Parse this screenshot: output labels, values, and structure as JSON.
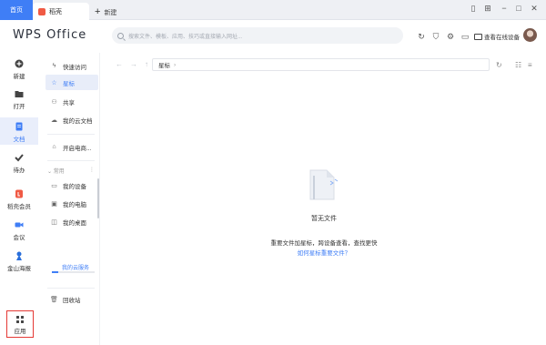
{
  "tabs": [
    {
      "label": "首页"
    },
    {
      "label": "稻壳"
    }
  ],
  "new_tab_label": "新建",
  "brand": "WPS Office",
  "search": {
    "placeholder": "搜索文件、模板、应用、技巧或直接输入网址..."
  },
  "header": {
    "device_label": "查看在线设备"
  },
  "rail": [
    {
      "label": "新建",
      "icon": "plus-circle-icon"
    },
    {
      "label": "打开",
      "icon": "folder-icon"
    },
    {
      "label": "文档",
      "icon": "document-icon",
      "active": true
    },
    {
      "label": "待办",
      "icon": "check-icon"
    },
    {
      "label": "稻壳会员",
      "icon": "daoke-icon"
    },
    {
      "label": "会议",
      "icon": "video-icon"
    },
    {
      "label": "金山海报",
      "icon": "poster-icon"
    },
    {
      "label": "应用",
      "icon": "apps-grid-icon"
    }
  ],
  "nav": {
    "items_top": [
      {
        "label": "快速访问",
        "icon": "lightning-icon"
      },
      {
        "label": "星标",
        "icon": "star-icon",
        "active": true
      },
      {
        "label": "共享",
        "icon": "share-icon"
      },
      {
        "label": "我的云文档",
        "icon": "cloud-icon"
      }
    ],
    "items_mid": [
      {
        "label": "开启电商...",
        "icon": "shop-icon"
      }
    ],
    "group_label": "常用",
    "items_common": [
      {
        "label": "我的设备",
        "icon": "devices-icon"
      },
      {
        "label": "我的电脑",
        "icon": "computer-icon"
      },
      {
        "label": "我的桌面",
        "icon": "desktop-icon"
      }
    ],
    "recycle": {
      "label": "回收站",
      "icon": "trash-icon"
    },
    "cloud_service": {
      "label": "我的云服务",
      "progress": 0.15
    }
  },
  "breadcrumb": {
    "current": "星标"
  },
  "empty_state": {
    "title": "暂无文件",
    "description": "重要文件加星标，跨设备查看，查找更快",
    "link": "如何星标重要文件？"
  },
  "colors": {
    "accent": "#3f7ef6",
    "highlight_box": "#e53935"
  }
}
